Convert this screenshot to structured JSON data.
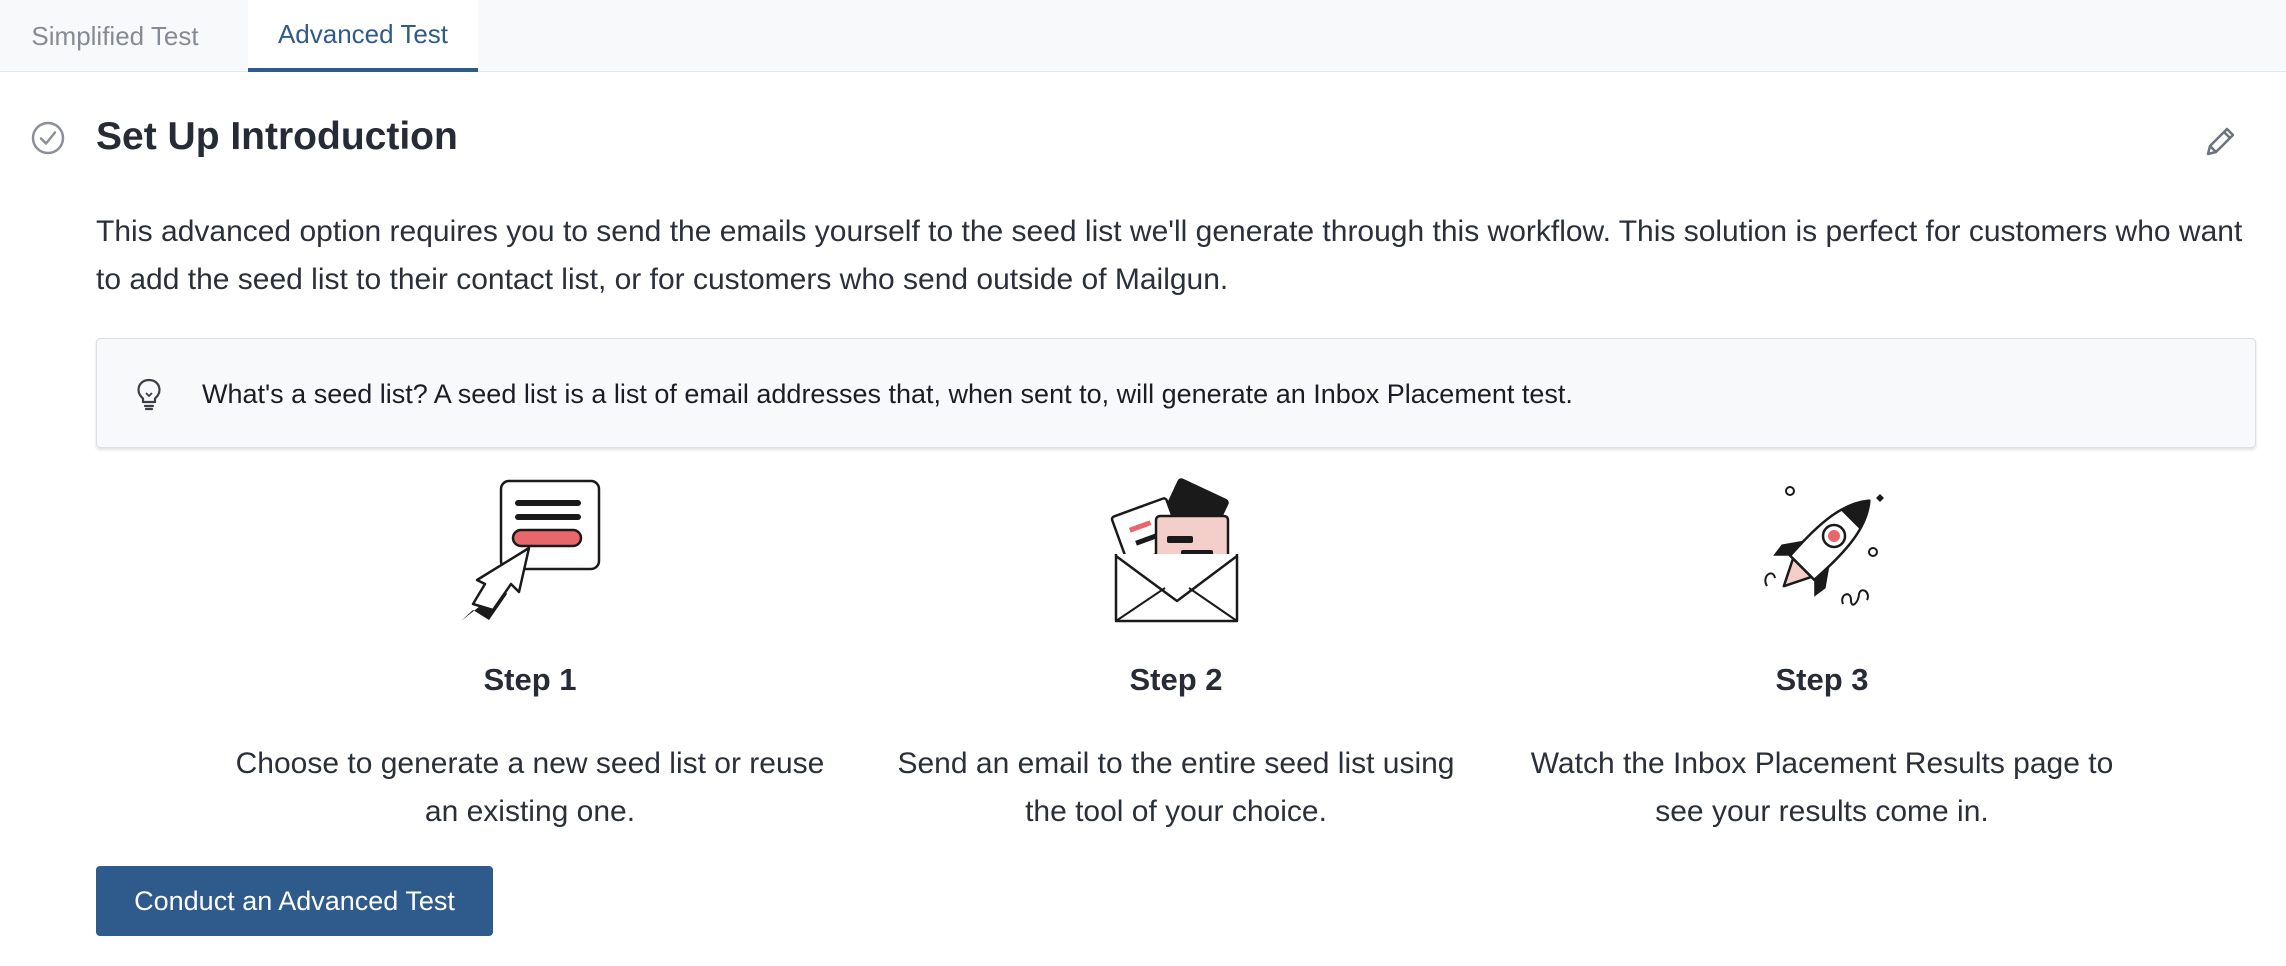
{
  "tabs": [
    {
      "label": "Simplified Test",
      "active": false
    },
    {
      "label": "Advanced Test",
      "active": true
    }
  ],
  "section": {
    "title": "Set Up Introduction",
    "status_icon": "check-circle-icon",
    "edit_icon": "pencil-icon"
  },
  "intro": "This advanced option requires you to send the emails yourself to the seed list we'll generate through this workflow. This solution is perfect for customers who want to add the seed list to their contact list, or for customers who send outside of Mailgun.",
  "callout": {
    "icon": "lightbulb-icon",
    "text": "What's a seed list? A seed list is a list of email addresses that, when sent to, will generate an Inbox Placement test."
  },
  "steps": [
    {
      "title": "Step 1",
      "description": "Choose to generate a new seed list or reuse an existing one.",
      "icon": "cursor-click-card-icon"
    },
    {
      "title": "Step 2",
      "description": "Send an email to the entire seed list using the tool of your choice.",
      "icon": "open-envelope-letters-icon"
    },
    {
      "title": "Step 3",
      "description": "Watch the Inbox Placement Results page to see your results come in.",
      "icon": "rocket-icon"
    }
  ],
  "cta_label": "Conduct an Advanced Test",
  "colors": {
    "accent": "#2f5a8c",
    "illustration_pink": "#e8676b",
    "illustration_light_pink": "#f4cfc9"
  }
}
